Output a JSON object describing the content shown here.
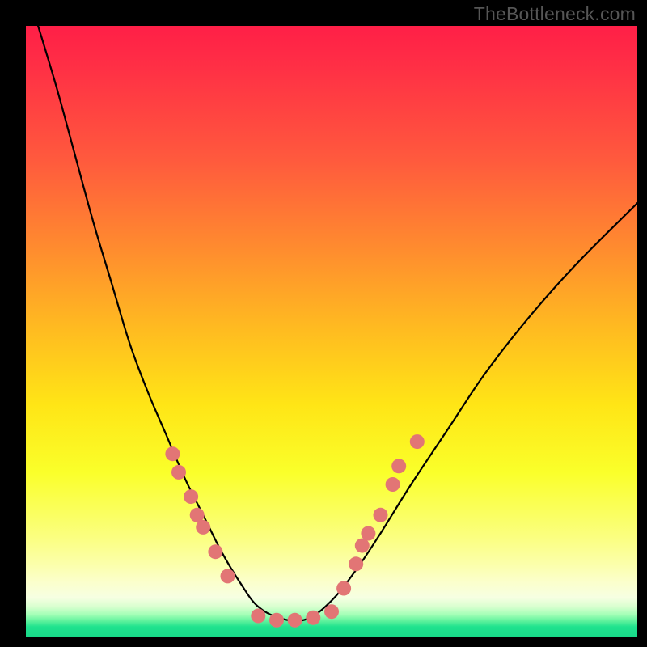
{
  "watermark": "TheBottleneck.com",
  "colors": {
    "background": "#000000",
    "marker": "#e27575",
    "curve": "#000000",
    "gradient_top": "#ff1f47",
    "gradient_bottom": "#18d988"
  },
  "chart_data": {
    "type": "line",
    "title": "",
    "xlabel": "",
    "ylabel": "",
    "xlim": [
      0,
      100
    ],
    "ylim": [
      0,
      100
    ],
    "axes_visible": false,
    "background": "vertical rainbow gradient (red top → yellow mid → green bottom) on black frame",
    "series": [
      {
        "name": "bottleneck-curve",
        "comment": "V-shaped curve; y is visual height percentage (0 bottom, 100 top). Bottom ~3% at x≈38–46.",
        "x": [
          2,
          5,
          8,
          11,
          14,
          17,
          20,
          23,
          26,
          29,
          32,
          35,
          38,
          42,
          46,
          50,
          54,
          58,
          63,
          69,
          75,
          82,
          90,
          100
        ],
        "y": [
          100,
          90,
          79,
          68,
          58,
          48,
          40,
          33,
          26,
          20,
          14,
          9,
          5,
          3,
          3,
          6,
          11,
          17,
          25,
          34,
          43,
          52,
          61,
          71
        ]
      }
    ],
    "markers": {
      "name": "highlighted-points",
      "comment": "Salmon circular markers clustered along the lower flanks and trough of the V.",
      "points_left": [
        [
          24,
          30
        ],
        [
          25,
          27
        ],
        [
          27,
          23
        ],
        [
          28,
          20
        ],
        [
          29,
          18
        ],
        [
          31,
          14
        ],
        [
          33,
          10
        ]
      ],
      "points_bottom": [
        [
          38,
          3.5
        ],
        [
          41,
          2.8
        ],
        [
          44,
          2.8
        ],
        [
          47,
          3.2
        ],
        [
          50,
          4.2
        ]
      ],
      "points_right": [
        [
          52,
          8
        ],
        [
          54,
          12
        ],
        [
          55,
          15
        ],
        [
          56,
          17
        ],
        [
          58,
          20
        ],
        [
          60,
          25
        ],
        [
          61,
          28
        ],
        [
          64,
          32
        ]
      ]
    }
  }
}
